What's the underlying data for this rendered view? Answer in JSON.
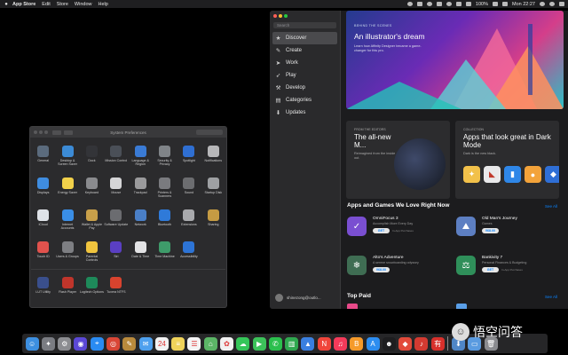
{
  "menubar": {
    "app_name": "App Store",
    "items": [
      "Edit",
      "Store",
      "Window",
      "Help"
    ],
    "battery": "100%",
    "clock": "Mon 22:27"
  },
  "syspref": {
    "title": "System Preferences",
    "rows": [
      [
        {
          "label": "General",
          "icon": "general-icon",
          "color": "#5b6b7d"
        },
        {
          "label": "Desktop & Screen Saver",
          "icon": "desktop-icon",
          "color": "#3c8bd6"
        },
        {
          "label": "Dock",
          "icon": "dock-icon",
          "color": "#333438"
        },
        {
          "label": "Mission Control",
          "icon": "mission-control-icon",
          "color": "#4a4f57"
        },
        {
          "label": "Language & Region",
          "icon": "language-icon",
          "color": "#3a7bd5"
        },
        {
          "label": "Security & Privacy",
          "icon": "security-icon",
          "color": "#808488"
        },
        {
          "label": "Spotlight",
          "icon": "spotlight-icon",
          "color": "#2f6fd2"
        },
        {
          "label": "Notifications",
          "icon": "notifications-icon",
          "color": "#b7b7b9"
        }
      ],
      [
        {
          "label": "Displays",
          "icon": "displays-icon",
          "color": "#3f8de0"
        },
        {
          "label": "Energy Saver",
          "icon": "energy-icon",
          "color": "#f2d14a"
        },
        {
          "label": "Keyboard",
          "icon": "keyboard-icon",
          "color": "#8a8b8e"
        },
        {
          "label": "Mouse",
          "icon": "mouse-icon",
          "color": "#d5d5d7"
        },
        {
          "label": "Trackpad",
          "icon": "trackpad-icon",
          "color": "#9a9a9c"
        },
        {
          "label": "Printers & Scanners",
          "icon": "printer-icon",
          "color": "#7a7b7f"
        },
        {
          "label": "Sound",
          "icon": "sound-icon",
          "color": "#6c6d70"
        },
        {
          "label": "Startup Disk",
          "icon": "disk-icon",
          "color": "#9ea0a3"
        }
      ],
      [
        {
          "label": "iCloud",
          "icon": "icloud-icon",
          "color": "#dfe3e8"
        },
        {
          "label": "Internet Accounts",
          "icon": "at-icon",
          "color": "#3a8ee6"
        },
        {
          "label": "Wallet & Apple Pay",
          "icon": "wallet-icon",
          "color": "#c8a04a"
        },
        {
          "label": "Software Update",
          "icon": "update-icon",
          "color": "#6b6c70"
        },
        {
          "label": "Network",
          "icon": "network-icon",
          "color": "#4a7fc7"
        },
        {
          "label": "Bluetooth",
          "icon": "bluetooth-icon",
          "color": "#2f7ad9"
        },
        {
          "label": "Extensions",
          "icon": "extensions-icon",
          "color": "#a8a9ac"
        },
        {
          "label": "Sharing",
          "icon": "sharing-icon",
          "color": "#c59b43"
        }
      ],
      [
        {
          "label": "Touch ID",
          "icon": "fingerprint-icon",
          "color": "#e1524d"
        },
        {
          "label": "Users & Groups",
          "icon": "users-icon",
          "color": "#7e7f83"
        },
        {
          "label": "Parental Controls",
          "icon": "parental-icon",
          "color": "#f0c43e"
        },
        {
          "label": "Siri",
          "icon": "siri-icon",
          "color": "#5a3fc2"
        },
        {
          "label": "Date & Time",
          "icon": "clock-icon",
          "color": "#e3e3e5"
        },
        {
          "label": "Time Machine",
          "icon": "time-machine-icon",
          "color": "#3e9b6a"
        },
        {
          "label": "Accessibility",
          "icon": "accessibility-icon",
          "color": "#2d74d6"
        }
      ],
      [
        {
          "label": "LUT Utility",
          "icon": "lut-icon",
          "color": "#3a4f8c"
        },
        {
          "label": "Flash Player",
          "icon": "flash-icon",
          "color": "#c0352b"
        },
        {
          "label": "Logitech Options",
          "icon": "logitech-icon",
          "color": "#1e8a5a"
        },
        {
          "label": "Tuxera NTFS",
          "icon": "tuxera-icon",
          "color": "#d8432e"
        }
      ]
    ]
  },
  "appstore": {
    "search_placeholder": "Search",
    "nav": [
      {
        "label": "Discover",
        "icon": "star-icon",
        "glyph": "★"
      },
      {
        "label": "Create",
        "icon": "brush-icon",
        "glyph": "✎"
      },
      {
        "label": "Work",
        "icon": "paper-plane-icon",
        "glyph": "➤"
      },
      {
        "label": "Play",
        "icon": "rocket-icon",
        "glyph": "➶"
      },
      {
        "label": "Develop",
        "icon": "hammer-icon",
        "glyph": "⚒"
      },
      {
        "label": "Categories",
        "icon": "categories-icon",
        "glyph": "▤"
      },
      {
        "label": "Updates",
        "icon": "updates-icon",
        "glyph": "⬇"
      }
    ],
    "user": "shinezong@outlo...",
    "hero": {
      "eyebrow": "BEHIND THE SCENES",
      "title": "An illustrator's dream",
      "subtitle": "Learn how Affinity Designer became a game-changer for this pro."
    },
    "card1": {
      "eyebrow": "FROM THE EDITORS",
      "title": "The all-new M...",
      "desc": "Reimagined from the inside out."
    },
    "card2": {
      "eyebrow": "COLLECTION",
      "title": "Apps that look great in Dark Mode",
      "desc": "Dark is the new black."
    },
    "section1": {
      "title": "Apps and Games We Love Right Now",
      "see_all": "See All"
    },
    "apps": [
      {
        "name": "OmniFocus 3",
        "category": "Accomplish More Every Day",
        "price": "GET",
        "iap": "In-App Purchases",
        "color": "#7a4fd1",
        "icon": "omnifocus-icon",
        "glyph": "✓"
      },
      {
        "name": "Old Man's Journey",
        "category": "Games",
        "price": "¥68.00",
        "iap": "",
        "color": "#5d7fc2",
        "icon": "old-man-icon",
        "glyph": "⛰"
      },
      {
        "name": "Alto's Adventure",
        "category": "A serene snowboarding odyssey",
        "price": "¥68.00",
        "iap": "",
        "color": "#3f6d53",
        "icon": "alto-icon",
        "glyph": "❄"
      },
      {
        "name": "Bankivity 7",
        "category": "Personal Finances & Budgeting",
        "price": "GET",
        "iap": "In-App Purchases",
        "color": "#2f8f5a",
        "icon": "bankivity-icon",
        "glyph": "⚖"
      }
    ],
    "section2": {
      "title": "Top Paid",
      "see_all": "See All"
    }
  },
  "dock": [
    {
      "icon": "finder-icon",
      "color": "#3d8fe0",
      "glyph": "☺"
    },
    {
      "icon": "launchpad-icon",
      "color": "#7a7c82",
      "glyph": "✦"
    },
    {
      "icon": "system-preferences-dock-icon",
      "color": "#8c8d91",
      "glyph": "⚙"
    },
    {
      "icon": "siri-dock-icon",
      "color": "#5b48d6",
      "glyph": "◉"
    },
    {
      "icon": "safari-icon",
      "color": "#2a8bf2",
      "glyph": "⌖"
    },
    {
      "icon": "chrome-icon",
      "color": "#d94636",
      "glyph": "◎"
    },
    {
      "icon": "notes-app-icon",
      "color": "#b98a3c",
      "glyph": "✎"
    },
    {
      "icon": "mail-icon",
      "color": "#4ea0ee",
      "glyph": "✉"
    },
    {
      "icon": "calendar-icon",
      "color": "#f2f2f2",
      "glyph": "24"
    },
    {
      "icon": "notes-icon",
      "color": "#f0d35a",
      "glyph": "≡"
    },
    {
      "icon": "reminders-icon",
      "color": "#f4f4f4",
      "glyph": "☰"
    },
    {
      "icon": "maps-icon",
      "color": "#5bb566",
      "glyph": "⌂"
    },
    {
      "icon": "photos-icon",
      "color": "#f1f1f1",
      "glyph": "✿"
    },
    {
      "icon": "messages-icon",
      "color": "#35c659",
      "glyph": "☁"
    },
    {
      "icon": "facetime-icon",
      "color": "#3cc25a",
      "glyph": "▶"
    },
    {
      "icon": "wechat-icon",
      "color": "#2bbf4d",
      "glyph": "✆"
    },
    {
      "icon": "numbers-icon",
      "color": "#2fa84f",
      "glyph": "▥"
    },
    {
      "icon": "keynote-icon",
      "color": "#3a7fe0",
      "glyph": "▲"
    },
    {
      "icon": "news-icon",
      "color": "#f0453b",
      "glyph": "N"
    },
    {
      "icon": "music-icon",
      "color": "#f43a5a",
      "glyph": "♫"
    },
    {
      "icon": "books-icon",
      "color": "#f59a2a",
      "glyph": "B"
    },
    {
      "icon": "app-store-icon",
      "color": "#2c8df0",
      "glyph": "A"
    },
    {
      "icon": "qq-icon",
      "color": "#1d1d1f",
      "glyph": "☻"
    },
    {
      "icon": "game-icon",
      "color": "#e24a3a",
      "glyph": "◆"
    },
    {
      "icon": "netease-music-icon",
      "color": "#d33a31",
      "glyph": "♪"
    },
    {
      "icon": "youdao-icon",
      "color": "#d8302b",
      "glyph": "有"
    },
    {
      "icon": "sep"
    },
    {
      "icon": "downloads-icon",
      "color": "#4f86c6",
      "glyph": "⬇"
    },
    {
      "icon": "folder-icon",
      "color": "#5a9be0",
      "glyph": "▭"
    },
    {
      "icon": "trash-icon",
      "color": "#8a8b8f",
      "glyph": "🗑"
    }
  ],
  "watermark": {
    "text": "悟空问答",
    "icon": "wukong-icon",
    "glyph": "☺"
  }
}
